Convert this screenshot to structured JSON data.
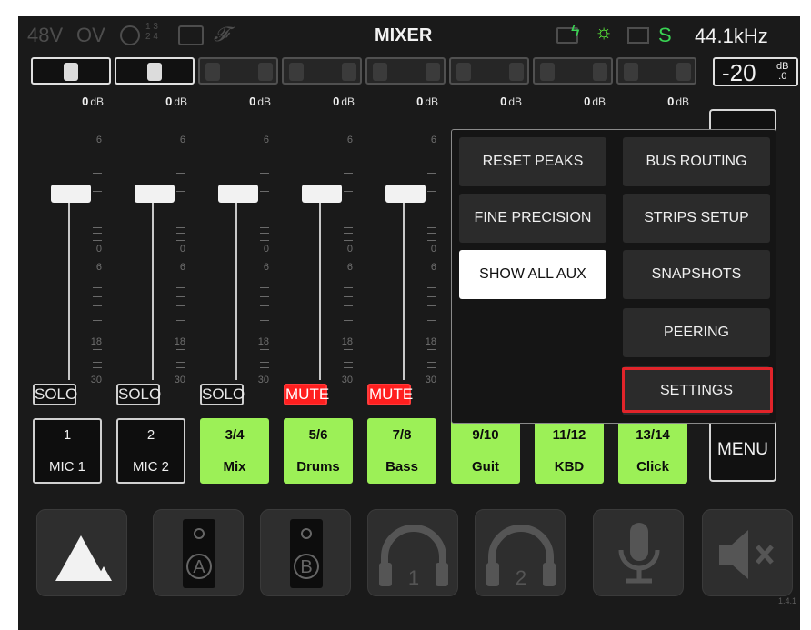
{
  "status": {
    "phantom": "48V",
    "overload": "OV",
    "link_numbers": "1 3\n2 4",
    "link_tb": "TB",
    "title": "MIXER",
    "sample_rate": "44.1kHz",
    "sync_indicator": "S"
  },
  "master": {
    "gain_value": "-20",
    "gain_unit": "dB\n.0"
  },
  "channels": [
    {
      "num": "1",
      "name": "MIC 1",
      "db": "0",
      "unit": "dB",
      "button": "SOLO",
      "muted": false,
      "aux": false,
      "gain_active": true
    },
    {
      "num": "2",
      "name": "MIC 2",
      "db": "0",
      "unit": "dB",
      "button": "SOLO",
      "muted": false,
      "aux": false,
      "gain_active": true
    },
    {
      "num": "3/4",
      "name": "Mix",
      "db": "0",
      "unit": "dB",
      "button": "SOLO",
      "muted": false,
      "aux": true,
      "gain_active": false
    },
    {
      "num": "5/6",
      "name": "Drums",
      "db": "0",
      "unit": "dB",
      "button": "MUTE",
      "muted": true,
      "aux": true,
      "gain_active": false
    },
    {
      "num": "7/8",
      "name": "Bass",
      "db": "0",
      "unit": "dB",
      "button": "MUTE",
      "muted": true,
      "aux": true,
      "gain_active": false
    },
    {
      "num": "9/10",
      "name": "Guit",
      "db": "0",
      "unit": "dB",
      "aux": true,
      "gain_active": false
    },
    {
      "num": "11/12",
      "name": "KBD",
      "db": "0",
      "unit": "dB",
      "aux": true,
      "gain_active": false
    },
    {
      "num": "13/14",
      "name": "Click",
      "db": "0",
      "unit": "dB",
      "aux": true,
      "gain_active": false
    }
  ],
  "fader_scale": [
    "6",
    "0",
    "6",
    "18",
    "30"
  ],
  "menu": {
    "button_label": "MENU",
    "items": [
      {
        "label": "RESET PEAKS",
        "selected": false
      },
      {
        "label": "BUS ROUTING",
        "selected": false
      },
      {
        "label": "FINE PRECISION",
        "selected": false
      },
      {
        "label": "STRIPS SETUP",
        "selected": false
      },
      {
        "label": "SHOW ALL AUX",
        "selected": true
      },
      {
        "label": "SNAPSHOTS",
        "selected": false
      },
      {
        "label": "PEERING",
        "selected": false
      },
      {
        "label": "SETTINGS",
        "selected": false,
        "highlighted": true
      }
    ]
  },
  "bottom": {
    "headphone_1": "1",
    "headphone_2": "2",
    "speaker_a": "A",
    "speaker_b": "B",
    "icons": [
      "logo-icon",
      "speaker-a-icon",
      "speaker-b-icon",
      "headphone-1-icon",
      "headphone-2-icon",
      "microphone-icon",
      "speaker-mute-icon"
    ]
  },
  "version": "1.4.1",
  "colors": {
    "aux_green": "#9cf057",
    "mute_red": "#ff1f1f",
    "highlight_red": "#e1242a",
    "status_green": "#39d353"
  }
}
